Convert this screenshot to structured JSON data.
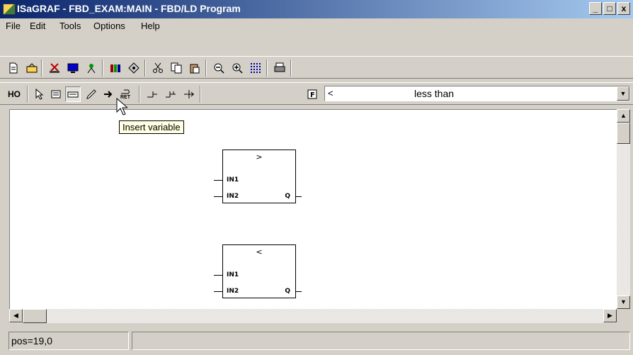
{
  "window": {
    "title": "ISaGRAF - FBD_EXAM:MAIN - FBD/LD Program",
    "icon": "app-icon",
    "controls": [
      "_",
      "□",
      "x"
    ]
  },
  "menu": [
    "File",
    "Edit",
    "Tools",
    "Options",
    "Help"
  ],
  "toolbar1": [
    {
      "name": "new-file-icon"
    },
    {
      "name": "open-file-icon"
    },
    {
      "name": "cut-icon"
    },
    {
      "name": "monitor-icon"
    },
    {
      "name": "debug-icon"
    },
    {
      "name": "library-icon"
    },
    {
      "name": "settings-icon"
    },
    {
      "name": "scissors-icon"
    },
    {
      "name": "copy-icon"
    },
    {
      "name": "paste-icon"
    },
    {
      "name": "zoom-out-icon"
    },
    {
      "name": "zoom-in-icon"
    },
    {
      "name": "grid-icon"
    },
    {
      "name": "print-icon"
    }
  ],
  "toolbar2": {
    "contact_label": "HO",
    "buttons": [
      {
        "name": "select-arrow-icon"
      },
      {
        "name": "insert-block-icon"
      },
      {
        "name": "insert-variable-icon",
        "pressed": true
      },
      {
        "name": "insert-comment-icon"
      },
      {
        "name": "insert-jump-icon"
      },
      {
        "name": "return-icon",
        "text": "RET"
      },
      {
        "name": "connect-icon"
      },
      {
        "name": "connect-branch-icon"
      },
      {
        "name": "vertical-link-icon"
      }
    ],
    "function_box_icon": "F",
    "combo": {
      "symbol": "<",
      "label": "less than"
    }
  },
  "tooltip": "Insert variable",
  "blocks": [
    {
      "operator": ">",
      "in1": "IN1",
      "in2": "IN2",
      "out": "Q"
    },
    {
      "operator": "<",
      "in1": "IN1",
      "in2": "IN2",
      "out": "Q"
    }
  ],
  "status": {
    "position": "pos=19,0",
    "message": ""
  },
  "scroll": {
    "up": "▲",
    "down": "▼",
    "left": "◀",
    "right": "▶",
    "combo_arrow": "▼"
  }
}
